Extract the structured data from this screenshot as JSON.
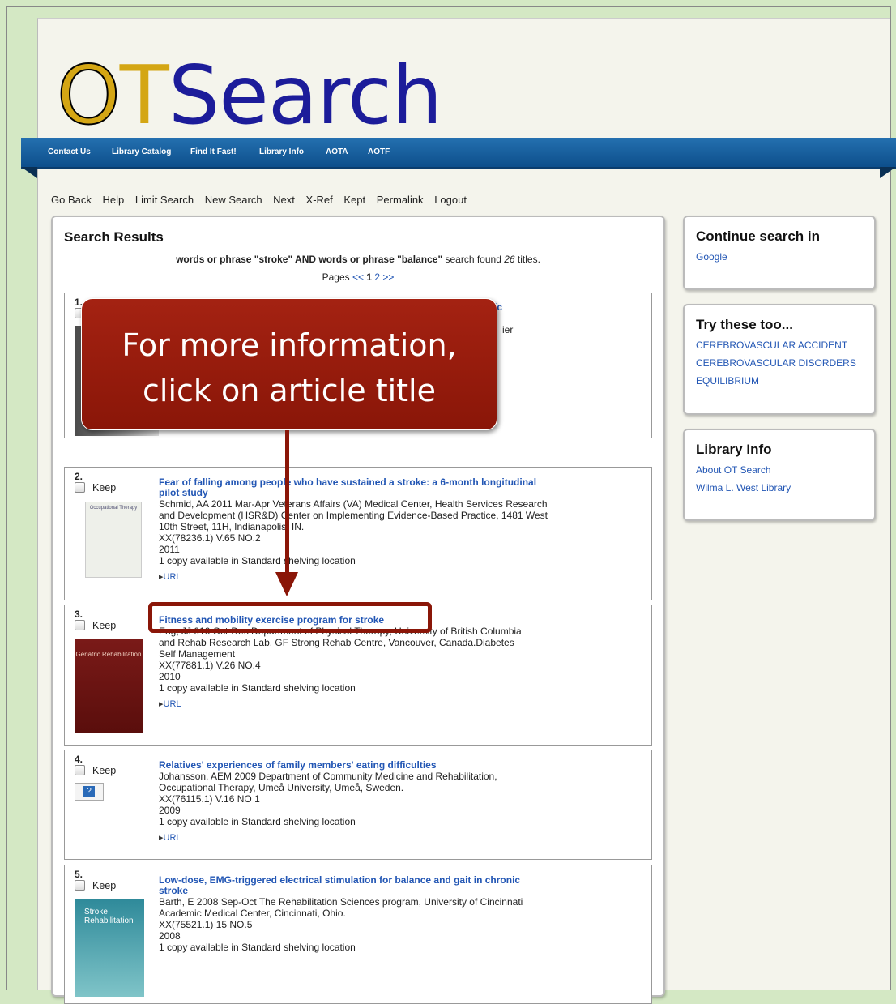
{
  "logo": {
    "o": "O",
    "t": "T",
    "rest": "Search"
  },
  "nav": [
    "Contact Us",
    "Library Catalog",
    "Find It Fast!",
    "Library Info",
    "AOTA",
    "AOTF"
  ],
  "toolbar": [
    "Go Back",
    "Help",
    "Limit Search",
    "New Search",
    "Next",
    "X-Ref",
    "Kept",
    "Permalink",
    "Logout"
  ],
  "results": {
    "heading": "Search Results",
    "summary_prefix": "words or phrase \"stroke\" AND words or phrase \"balance\"",
    "summary_mid": " search found ",
    "count": "26",
    "summary_suffix": " titles.",
    "pages_label": "Pages",
    "prev": "<<",
    "current_page": "1",
    "next_page": "2",
    "next": ">>",
    "keep_label": "Keep",
    "url_label": "URL",
    "records": [
      {
        "num": "1.",
        "title_tail": "ic",
        "author_tail": "ier"
      },
      {
        "num": "2.",
        "title": "Fear of falling among people who have sustained a stroke: a 6-month longitudinal pilot study",
        "author": "Schmid, AA 2011 Mar-Apr Veterans Affairs (VA) Medical Center, Health Services Research and Development (HSR&D) Center on Implementing Evidence-Based Practice, 1481 West 10th Street, 11H, Indianapolis, IN.",
        "call": "XX(78236.1) V.65 NO.2",
        "year": "2011",
        "avail": "1 copy available in Standard shelving location"
      },
      {
        "num": "3.",
        "title": "Fitness and mobility exercise program for stroke",
        "author": "Eng, JJ 010 Oct-Dec Department of Physical Therapy, University of British Columbia and Rehab Research Lab, GF Strong Rehab Centre, Vancouver, Canada.Diabetes Self Management",
        "call": "XX(77881.1) V.26 NO.4",
        "year": "2010",
        "avail": "1 copy available in Standard shelving location"
      },
      {
        "num": "4.",
        "title": "Relatives' experiences of family members' eating difficulties",
        "author": "Johansson, AEM 2009 Department of Community Medicine and Rehabilitation, Occupational Therapy, Umeå University, Umeå, Sweden.",
        "call": "XX(76115.1) V.16 NO 1",
        "year": "2009",
        "avail": "1 copy available in Standard shelving location"
      },
      {
        "num": "5.",
        "title": "Low-dose, EMG-triggered electrical stimulation for balance and gait in chronic stroke",
        "author": "Barth, E 2008 Sep-Oct The Rehabilitation Sciences program, University of Cincinnati Academic Medical Center, Cincinnati, Ohio.",
        "call": "XX(75521.1) 15 NO.5",
        "year": "2008",
        "avail": "1 copy available in Standard shelving location"
      }
    ]
  },
  "sidebar": {
    "continue": {
      "heading": "Continue search in",
      "links": [
        "Google"
      ]
    },
    "try": {
      "heading": "Try these too...",
      "links": [
        "CEREBROVASCULAR ACCIDENT",
        "CEREBROVASCULAR DISORDERS",
        "EQUILIBRIUM"
      ]
    },
    "info": {
      "heading": "Library Info",
      "links": [
        "About OT Search",
        "Wilma L. West Library"
      ]
    }
  },
  "covers": {
    "r2": "Occupational Therapy",
    "r3": "Geriatric Rehabilitation",
    "r5": "Stroke Rehabilitation"
  },
  "callout": {
    "line1": "For more information,",
    "line2": "click on article title"
  },
  "colors": {
    "link": "#2256b4",
    "nav": "#0d4f8c",
    "callout": "#8a1608",
    "logo_gold": "#d4a614",
    "logo_blue": "#1c1c9a"
  }
}
